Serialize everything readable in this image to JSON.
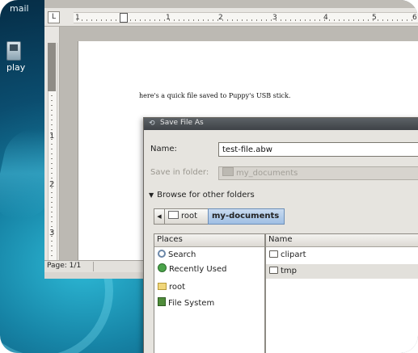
{
  "desktop": {
    "top_label": "mail",
    "play_label": "play"
  },
  "document_window": {
    "ruler_numbers": [
      "1",
      "2",
      "3",
      "4",
      "5",
      "6"
    ],
    "vruler_numbers": [
      "1",
      "2",
      "3"
    ],
    "body_text": "here's a quick file saved to Puppy's USB stick.",
    "status": "Page: 1/1"
  },
  "save_dialog": {
    "title": "Save File As",
    "name_label": "Name:",
    "name_value": "test-file.abw",
    "save_in_label": "Save in folder:",
    "save_in_value": "my_documents",
    "browse_label": "Browse for other folders",
    "path": [
      "root",
      "my-documents"
    ],
    "places_header": "Places",
    "places": [
      {
        "label": "Search",
        "icon": "search-icon"
      },
      {
        "label": "Recently Used",
        "icon": "recent-icon"
      },
      {
        "label": "root",
        "icon": "home-folder-icon"
      },
      {
        "label": "File System",
        "icon": "filesystem-icon"
      }
    ],
    "files_header": "Name",
    "files": [
      {
        "label": "clipart",
        "icon": "folder-icon"
      },
      {
        "label": "tmp",
        "icon": "folder-icon"
      }
    ]
  }
}
